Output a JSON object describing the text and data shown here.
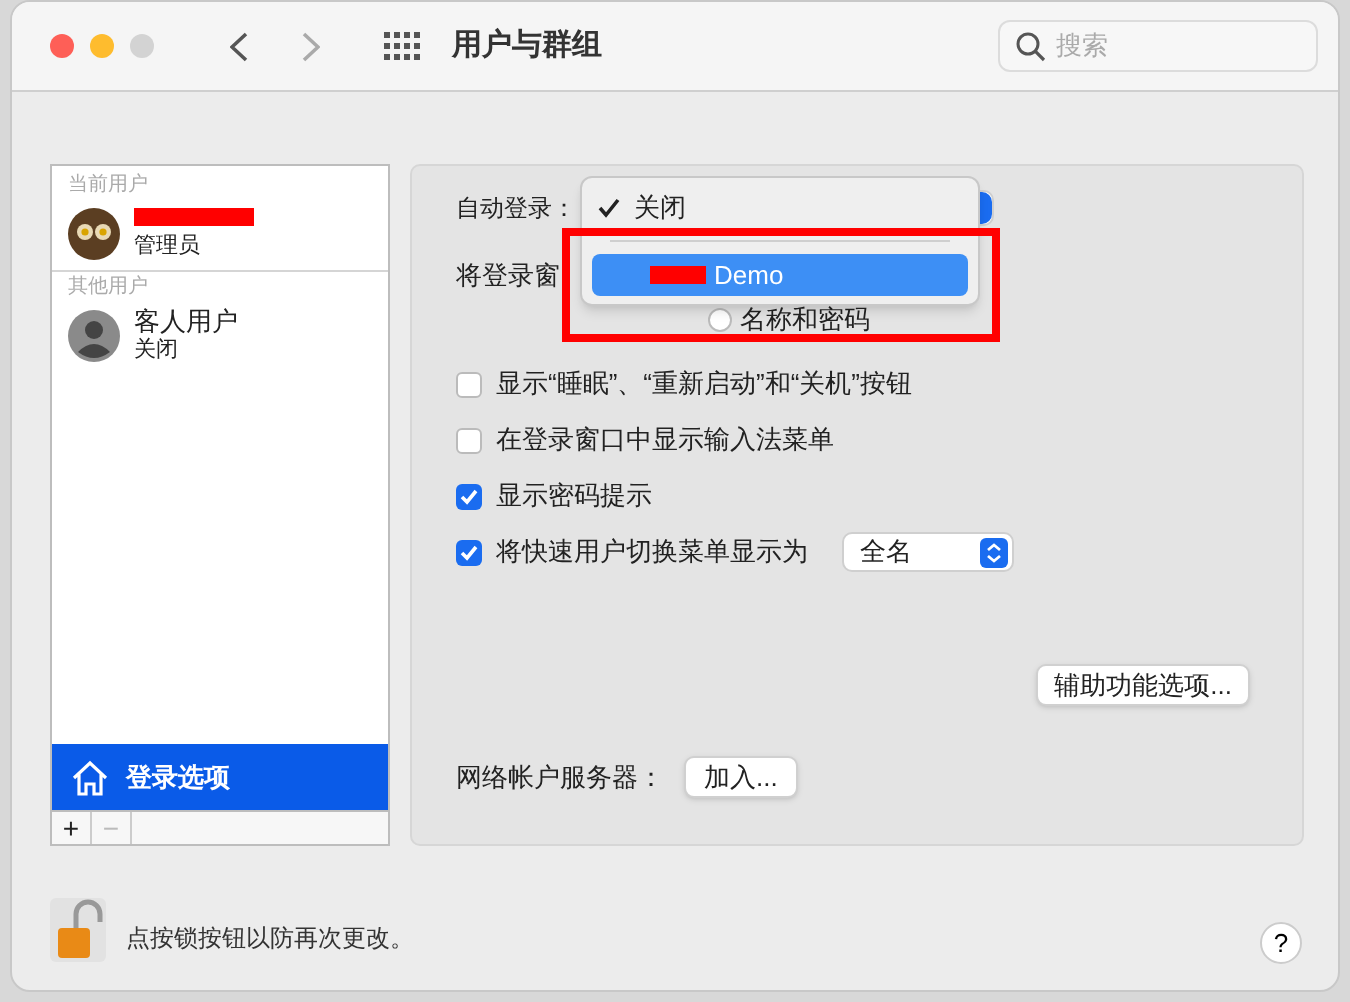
{
  "window": {
    "title": "用户与群组",
    "search_placeholder": "搜索"
  },
  "sidebar": {
    "sections": [
      {
        "heading": "当前用户",
        "users": [
          {
            "kind": "owl",
            "role": "管理员",
            "redacted": true
          }
        ]
      },
      {
        "heading": "其他用户",
        "users": [
          {
            "kind": "guest",
            "name": "客人用户",
            "role": "关闭",
            "redacted": false
          }
        ]
      }
    ],
    "login_options": {
      "label": "登录选项",
      "selected": true
    },
    "add": "+",
    "remove": "−"
  },
  "autologin": {
    "label": "自动登录：",
    "menu": [
      {
        "label": "关闭",
        "checked": true,
        "selected": false,
        "redacted": false
      },
      {
        "label": "Demo",
        "checked": false,
        "selected": true,
        "redacted": true
      }
    ]
  },
  "display_label": "将登录窗",
  "radio": {
    "label": "名称和密码",
    "selected": false
  },
  "checkboxes": [
    {
      "label": "显示“睡眠”、“重新启动”和“关机”按钮",
      "checked": false
    },
    {
      "label": "在登录窗口中显示输入法菜单",
      "checked": false
    },
    {
      "label": "显示密码提示",
      "checked": true
    },
    {
      "label": "将快速用户切换菜单显示为",
      "checked": true,
      "popup": "全名"
    }
  ],
  "accessibility_button": "辅助功能选项...",
  "network": {
    "label": "网络帐户服务器：",
    "button": "加入..."
  },
  "lock_text": "点按锁按钮以防再次更改。",
  "help": "?"
}
